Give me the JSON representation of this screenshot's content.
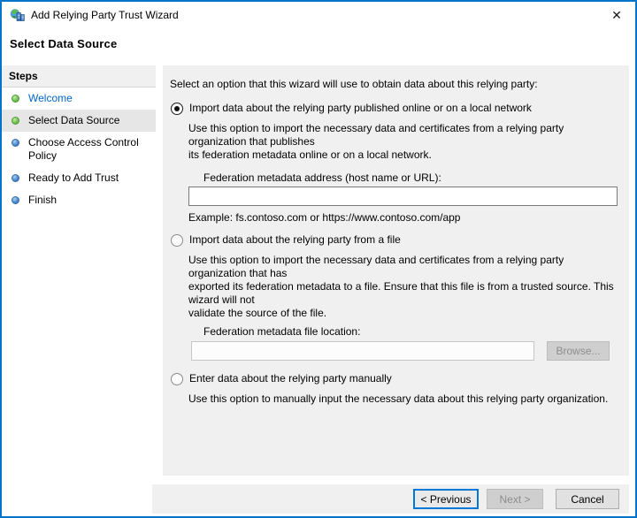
{
  "window": {
    "title": "Add Relying Party Trust Wizard",
    "close_glyph": "✕"
  },
  "header": {
    "title": "Select Data Source"
  },
  "sidebar": {
    "title": "Steps",
    "items": [
      {
        "label": "Welcome",
        "state": "done",
        "active": false,
        "link": true
      },
      {
        "label": "Select Data Source",
        "state": "done",
        "active": true,
        "link": false
      },
      {
        "label": "Choose Access Control Policy",
        "state": "todo",
        "active": false,
        "link": false
      },
      {
        "label": "Ready to Add Trust",
        "state": "todo",
        "active": false,
        "link": false
      },
      {
        "label": "Finish",
        "state": "todo",
        "active": false,
        "link": false
      }
    ]
  },
  "content": {
    "intro": "Select an option that this wizard will use to obtain data about this relying party:",
    "options": [
      {
        "label": "Import data about the relying party published online or on a local network",
        "selected": true,
        "description": "Use this option to import the necessary data and certificates from a relying party organization that publishes\nits federation metadata online or on a local network.",
        "field_label": "Federation metadata address (host name or URL):",
        "field_value": "",
        "example": "Example: fs.contoso.com or https://www.contoso.com/app"
      },
      {
        "label": "Import data about the relying party from a file",
        "selected": false,
        "description": "Use this option to import the necessary data and certificates from a relying party organization that has\nexported its federation metadata to a file. Ensure that this file is from a trusted source.  This wizard will not\nvalidate the source of the file.",
        "field_label": "Federation metadata file location:",
        "field_value": "",
        "browse_label": "Browse..."
      },
      {
        "label": "Enter data about the relying party manually",
        "selected": false,
        "description": "Use this option to manually input the necessary data about this relying party organization."
      }
    ]
  },
  "footer": {
    "previous_label": "< Previous",
    "next_label": "Next >",
    "cancel_label": "Cancel"
  },
  "colors": {
    "window_border": "#0473c8",
    "panel_background": "#f0f0f0",
    "step_link": "#0066cc",
    "step_done_bullet": "#6abf4b",
    "step_todo_bullet": "#4485cf",
    "focus_border": "#0078d7"
  }
}
